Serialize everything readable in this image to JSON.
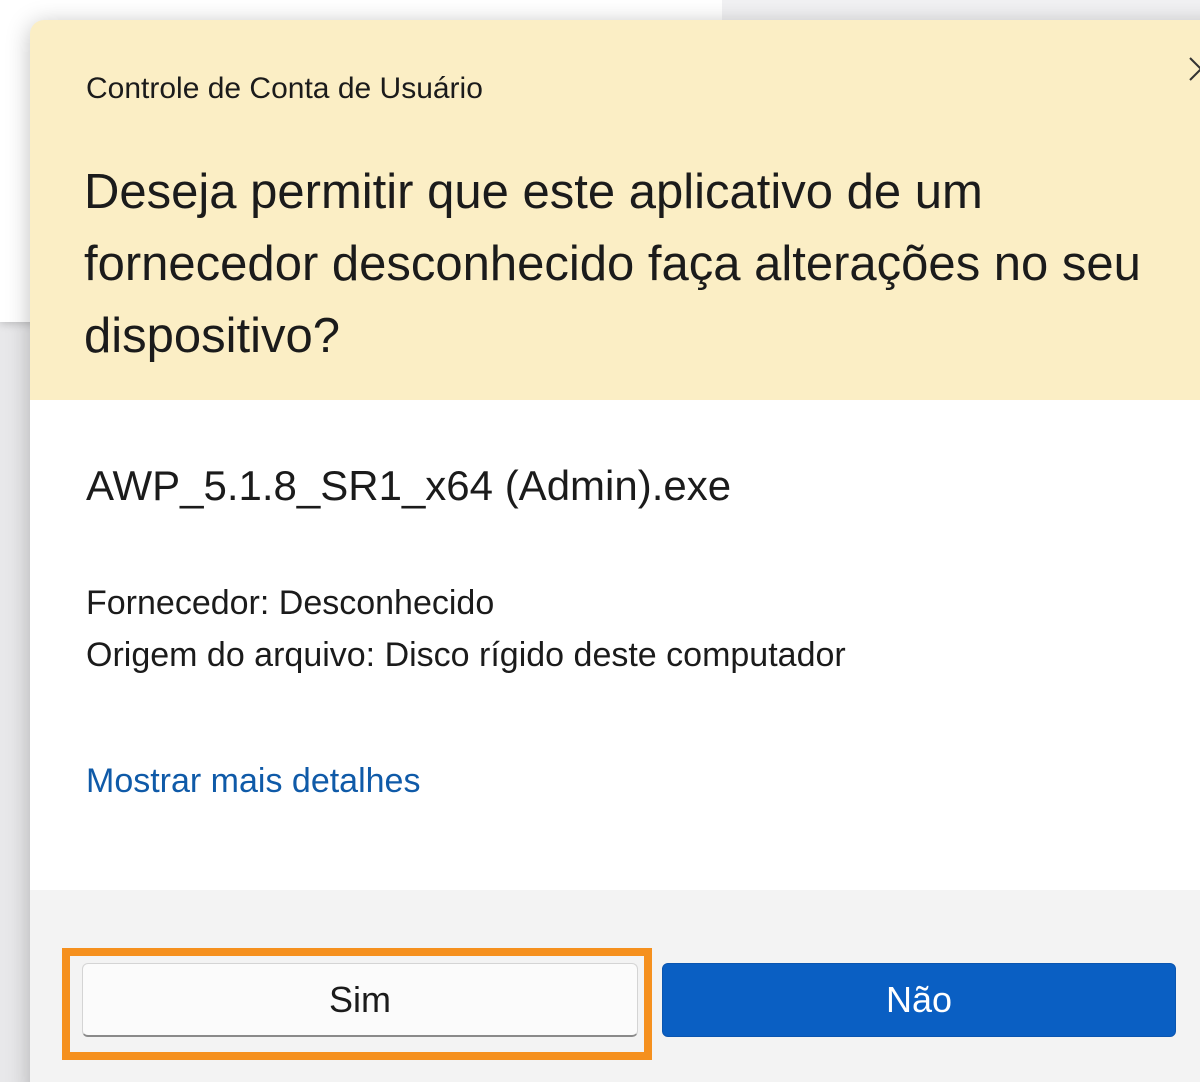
{
  "dialog": {
    "window_title": "Controle de Conta de Usuário",
    "question": "Deseja permitir que este aplicativo de um fornecedor desconhecido faça alterações no seu dispositivo?",
    "app_name": "AWP_5.1.8_SR1_x64 (Admin).exe",
    "publisher": "Fornecedor: Desconhecido",
    "file_origin": "Origem do arquivo: Disco rígido deste computador",
    "details_link": "Mostrar mais detalhes",
    "buttons": {
      "yes": "Sim",
      "no": "Não"
    }
  },
  "colors": {
    "header_bg": "#fbeec5",
    "link": "#0f5aa8",
    "primary_button": "#0a5fc3",
    "highlight": "#f5901e"
  },
  "icons": {
    "close": "close-icon"
  }
}
